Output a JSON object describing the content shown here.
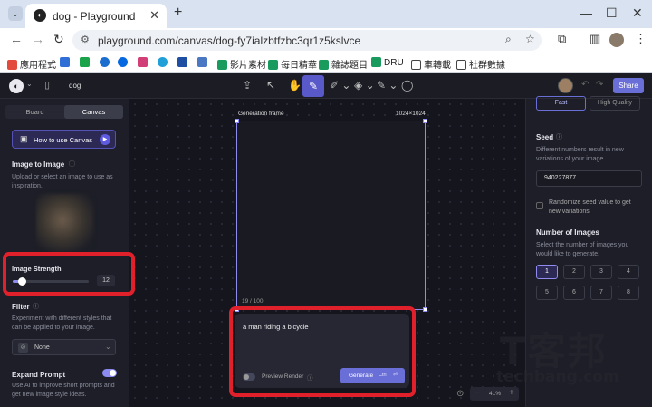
{
  "browser": {
    "tab_title": "dog - Playground",
    "tab_close": "✕",
    "new_tab": "+",
    "url": "playground.com/canvas/dog-fy7ialzbtfzbc3qr1z5kslvce",
    "bookmarks": [
      "應用程式",
      "",
      "",
      "",
      "",
      "",
      "",
      "",
      "影片素材",
      "每日精華",
      "雜誌題目",
      "DRU",
      "車轉載",
      "社群數據"
    ]
  },
  "app": {
    "project_name": "dog",
    "share_label": "Share",
    "left": {
      "tabs": [
        "Board",
        "Canvas"
      ],
      "active_tab": "Canvas",
      "how_to": "How to use Canvas",
      "image_to_image": "Image to Image",
      "image_to_image_desc": "Upload or select an image to use as inspiration.",
      "strength_label": "Image Strength",
      "strength_value": "12",
      "strength_fraction": 0.12,
      "filter_label": "Filter",
      "filter_desc": "Experiment with different styles that can be applied to your image.",
      "filter_value": "None",
      "expand_label": "Expand Prompt",
      "expand_desc": "Use AI to improve short prompts and get new image style ideas."
    },
    "canvas": {
      "frame_label": "Generation frame",
      "frame_size": "1024×1024",
      "counter": "19 / 100",
      "prompt": "a man riding a bicycle",
      "preview_label": "Preview Render",
      "generate_label": "Generate",
      "generate_shortcut": "Ctrl",
      "zoom": "41%"
    },
    "right": {
      "quality_options": [
        "Fast",
        "High Quality"
      ],
      "seed_label": "Seed",
      "seed_desc": "Different numbers result in new variations of your image.",
      "seed_value": "940227877",
      "randomize_label": "Randomize seed value to get new variations",
      "num_label": "Number of Images",
      "num_desc": "Select the number of images you would like to generate.",
      "numbers": [
        "1",
        "2",
        "3",
        "4",
        "5",
        "6",
        "7",
        "8"
      ],
      "selected_number": "1"
    },
    "watermark": {
      "brand": "T客邦",
      "site": "techbang.com"
    }
  }
}
